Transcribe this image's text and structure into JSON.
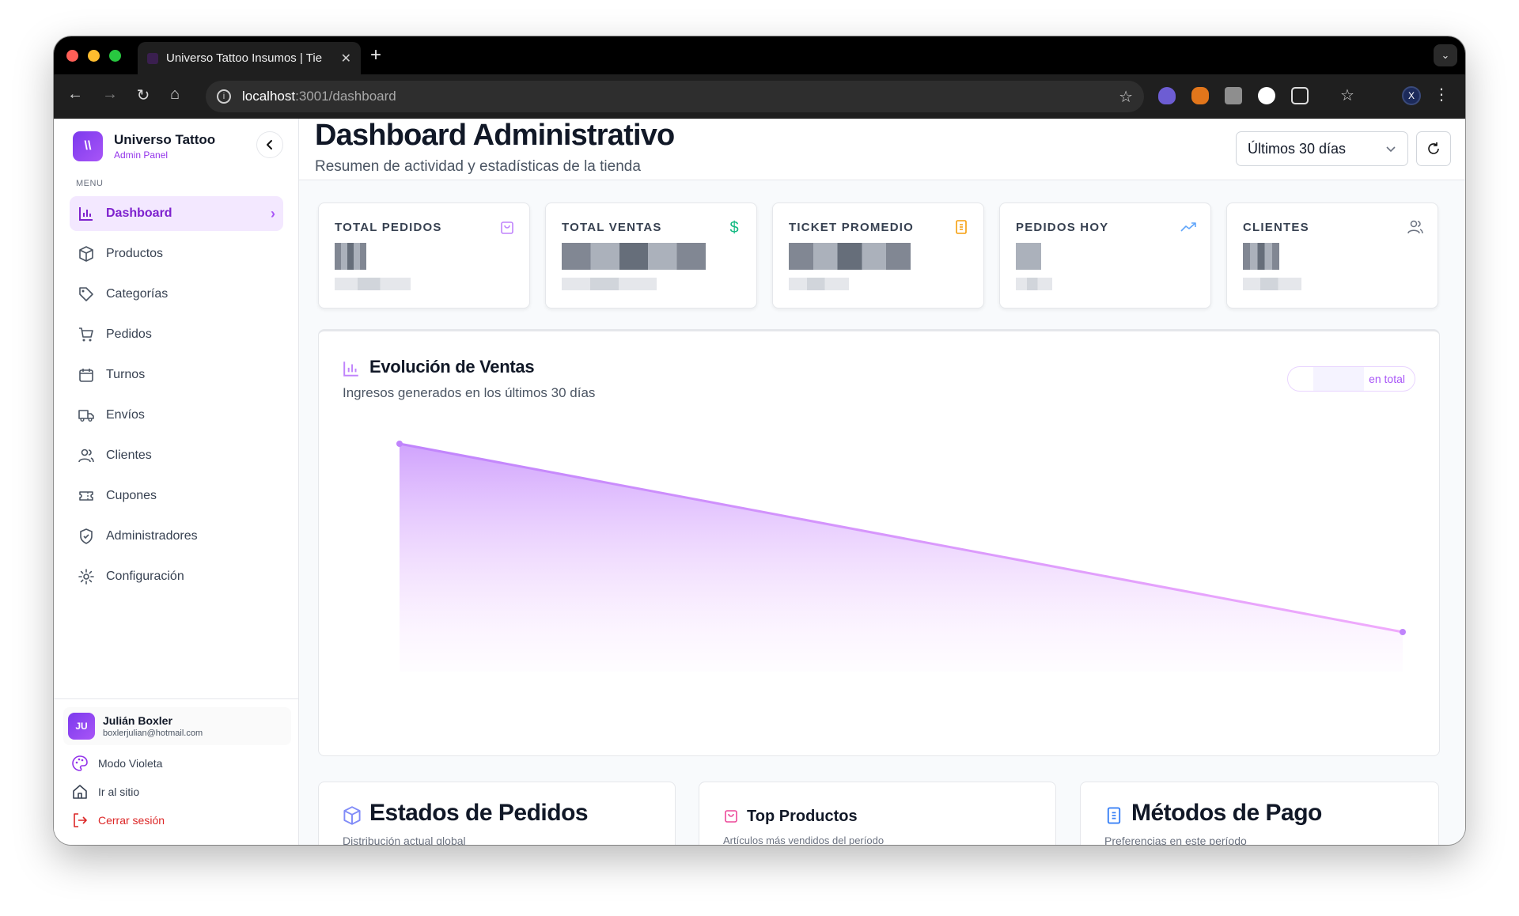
{
  "browser": {
    "tab_title": "Universo Tattoo Insumos | Tie",
    "url_host": "localhost",
    "url_path": ":3001/dashboard",
    "profile_initial": "X"
  },
  "sidebar": {
    "brand_name": "Universo Tattoo",
    "brand_sub": "Admin Panel",
    "menu_label": "MENU",
    "items": [
      {
        "label": "Dashboard",
        "icon": "bar-chart-icon"
      },
      {
        "label": "Productos",
        "icon": "package-icon"
      },
      {
        "label": "Categorías",
        "icon": "tag-icon"
      },
      {
        "label": "Pedidos",
        "icon": "shopping-cart-icon"
      },
      {
        "label": "Turnos",
        "icon": "calendar-icon"
      },
      {
        "label": "Envíos",
        "icon": "truck-icon"
      },
      {
        "label": "Clientes",
        "icon": "users-icon"
      },
      {
        "label": "Cupones",
        "icon": "ticket-icon"
      },
      {
        "label": "Administradores",
        "icon": "shield-icon"
      },
      {
        "label": "Configuración",
        "icon": "gear-icon"
      }
    ],
    "user": {
      "initials": "JU",
      "name": "Julián Boxler",
      "email": "boxlerjulian@hotmail.com"
    },
    "links": {
      "theme": "Modo Violeta",
      "site": "Ir al sitio",
      "logout": "Cerrar sesión"
    }
  },
  "header": {
    "title": "Dashboard Administrativo",
    "subtitle": "Resumen de actividad y estadísticas de la tienda",
    "range": "Últimos 30 días"
  },
  "stats": [
    {
      "label": "TOTAL PEDIDOS",
      "icon": "shopping-bag-icon",
      "color": "#c084fc"
    },
    {
      "label": "TOTAL VENTAS",
      "icon": "dollar-icon",
      "color": "#10b981"
    },
    {
      "label": "TICKET PROMEDIO",
      "icon": "receipt-icon",
      "color": "#f59e0b"
    },
    {
      "label": "PEDIDOS HOY",
      "icon": "trending-up-icon",
      "color": "#60a5fa"
    },
    {
      "label": "CLIENTES",
      "icon": "users-icon",
      "color": "#6b7280"
    }
  ],
  "sales_chart": {
    "title": "Evolución de Ventas",
    "subtitle": "Ingresos generados en los últimos 30 días",
    "badge_suffix": "en total",
    "line_color": "#c084fc",
    "series_trend": "decreasing"
  },
  "bottom_cards": [
    {
      "title": "Estados de Pedidos",
      "subtitle": "Distribución actual global",
      "icon": "box-icon"
    },
    {
      "title": "Top Productos",
      "subtitle": "Artículos más vendidos del período",
      "icon": "shopping-bag-icon"
    },
    {
      "title": "Métodos de Pago",
      "subtitle": "Preferencias en este período",
      "icon": "receipt-icon"
    }
  ]
}
